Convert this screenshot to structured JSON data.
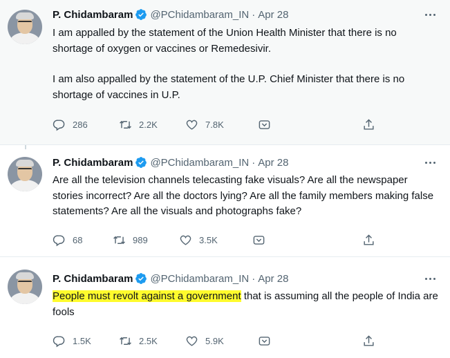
{
  "colors": {
    "verified": "#1d9bf0",
    "muted": "#536471",
    "highlight": "#fffb2d"
  },
  "tweets": [
    {
      "name": "P. Chidambaram",
      "handle": "@PChidambaram_IN",
      "separator": "·",
      "date": "Apr 28",
      "paragraphs": [
        "I am appalled by the statement of the Union Health Minister that there is no shortage of oxygen or vaccines or Remedesivir.",
        "I am also appalled by the statement of the U.P. Chief Minister that there is no shortage of vaccines in U.P."
      ],
      "replies": "286",
      "retweets": "2.2K",
      "likes": "7.8K"
    },
    {
      "name": "P. Chidambaram",
      "handle": "@PChidambaram_IN",
      "separator": "·",
      "date": "Apr 28",
      "paragraphs": [
        "Are all the television channels telecasting fake visuals? Are all the newspaper stories incorrect? Are all the doctors lying? Are all the family members making false statements? Are all the visuals and photographs fake?"
      ],
      "replies": "68",
      "retweets": "989",
      "likes": "3.5K"
    },
    {
      "name": "P. Chidambaram",
      "handle": "@PChidambaram_IN",
      "separator": "·",
      "date": "Apr 28",
      "highlighted": "People must revolt against a government",
      "rest": " that is assuming all the people of India are fools",
      "replies": "1.5K",
      "retweets": "2.5K",
      "likes": "5.9K"
    }
  ]
}
